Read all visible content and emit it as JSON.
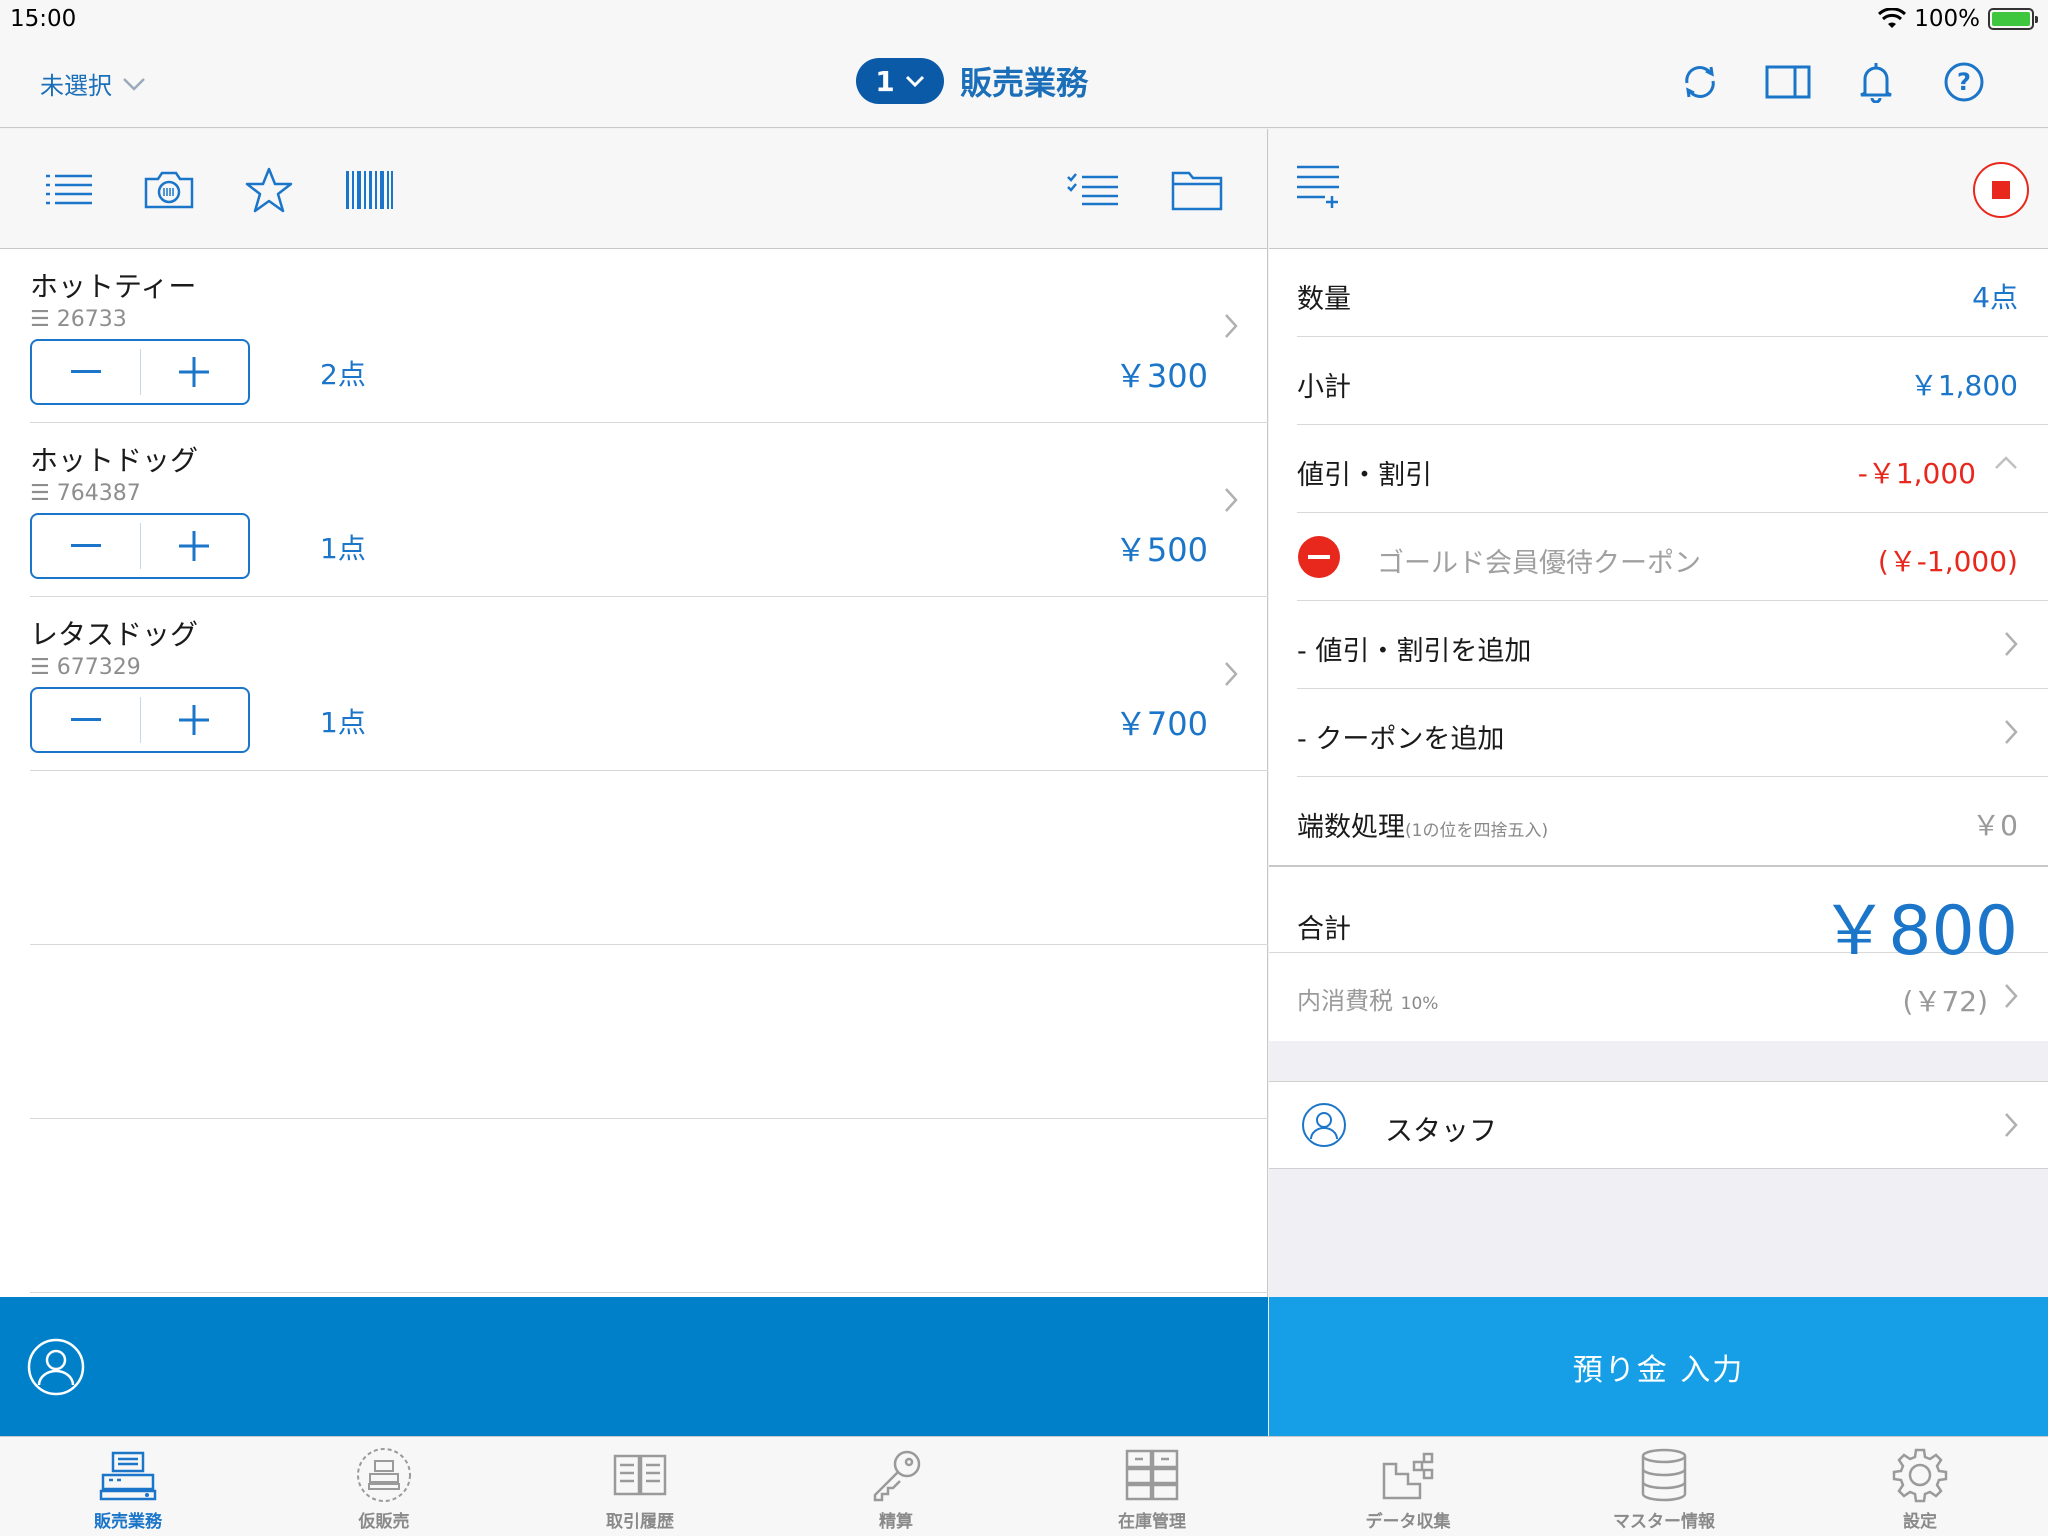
{
  "status": {
    "time": "15:00",
    "battery": "100%"
  },
  "nav": {
    "store_label": "未選択",
    "register_number": "1",
    "title": "販売業務"
  },
  "items": [
    {
      "name": "ホットティー",
      "code": "26733",
      "qty": "2点",
      "price": "￥300"
    },
    {
      "name": "ホットドッグ",
      "code": "764387",
      "qty": "1点",
      "price": "￥500"
    },
    {
      "name": "レタスドッグ",
      "code": "677329",
      "qty": "1点",
      "price": "￥700"
    }
  ],
  "summary": {
    "quantity_label": "数量",
    "quantity_value": "4点",
    "subtotal_label": "小計",
    "subtotal_value": "￥1,800",
    "discount_label": "値引・割引",
    "discount_value": "-￥1,000",
    "coupon_name": "ゴールド会員優待クーポン",
    "coupon_value": "(￥-1,000)",
    "add_discount_label": "- 値引・割引を追加",
    "add_coupon_label": "- クーポンを追加",
    "rounding_label": "端数処理",
    "rounding_note": "(1の位を四捨五入)",
    "rounding_value": "￥0",
    "total_label": "合計",
    "total_value": "￥800",
    "tax_label": "内消費税",
    "tax_rate": "10%",
    "tax_value": "(￥72)",
    "staff_label": "スタッフ"
  },
  "deposit_label": "預り金 入力",
  "tabs": [
    {
      "label": "販売業務",
      "icon": "register-icon",
      "active": true
    },
    {
      "label": "仮販売",
      "icon": "temp-sale-icon"
    },
    {
      "label": "取引履歴",
      "icon": "history-book-icon"
    },
    {
      "label": "精算",
      "icon": "key-icon"
    },
    {
      "label": "在庫管理",
      "icon": "inventory-icon"
    },
    {
      "label": "データ収集",
      "icon": "data-collect-icon"
    },
    {
      "label": "マスター情報",
      "icon": "database-icon"
    },
    {
      "label": "設定",
      "icon": "gear-icon"
    }
  ],
  "colors": {
    "accent": "#1b75c9",
    "customer_bar": "#0080c9",
    "deposit_bar": "#169fe6",
    "discount": "#e8281c"
  }
}
